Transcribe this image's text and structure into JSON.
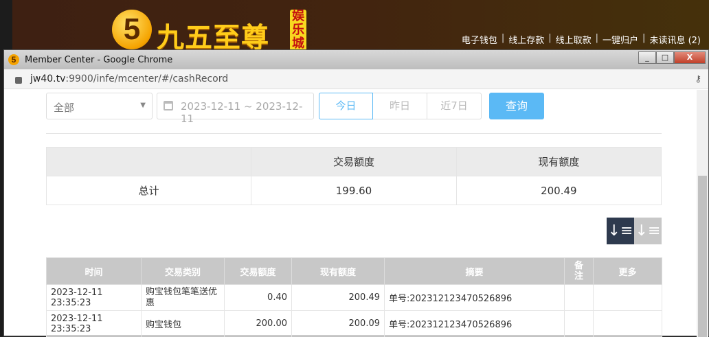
{
  "banner": {
    "logo_text": "九五至尊",
    "logo_tag": "娱乐城",
    "links": [
      "电子钱包",
      "线上存款",
      "线上取款",
      "一键归户",
      "未读讯息 (2)"
    ]
  },
  "window": {
    "title": "Member Center - Google Chrome",
    "url_host": "jw40.tv",
    "url_rest": ":9900/infe/mcenter/#/cashRecord"
  },
  "filters": {
    "type": "全部",
    "date_range": "2023-12-11 ~ 2023-12-11",
    "today": "今日",
    "yesterday": "昨日",
    "last7": "近7日",
    "query": "查询"
  },
  "summary": {
    "headers": [
      "",
      "交易额度",
      "现有额度"
    ],
    "row": [
      "总计",
      "199.60",
      "200.49"
    ]
  },
  "table": {
    "headers": [
      "时间",
      "交易类别",
      "交易额度",
      "现有额度",
      "摘要",
      "备注",
      "更多"
    ],
    "rows": [
      [
        "2023-12-11 23:35:23",
        "购宝钱包笔笔送优惠",
        "0.40",
        "200.49",
        "单号:202312123470526896",
        "",
        ""
      ],
      [
        "2023-12-11 23:35:23",
        "购宝钱包",
        "200.00",
        "200.09",
        "单号:202312123470526896",
        "",
        ""
      ]
    ]
  }
}
